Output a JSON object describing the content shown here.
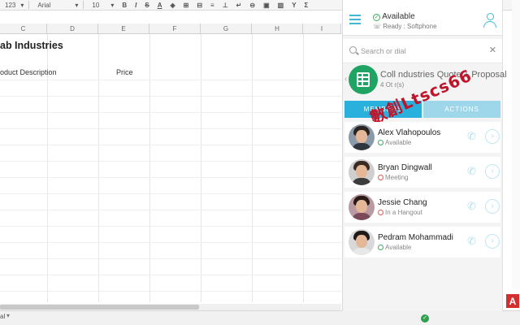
{
  "toolbar": {
    "zoom_text": "123",
    "font_name": "Arial",
    "font_size": "10",
    "bold_label": "B",
    "italic_label": "I",
    "strike_label": "S",
    "color_label": "A"
  },
  "sheet": {
    "columns": [
      "C",
      "D",
      "E",
      "F",
      "G",
      "H",
      "I"
    ],
    "title_cell": "ab Industries",
    "desc_header": "oduct Description",
    "price_header": "Price",
    "tab_label": "al"
  },
  "panel": {
    "status": "Available",
    "device": "Ready : Softphone",
    "search_placeholder": "Search or dial",
    "clear_glyph": "✕",
    "doc_title": "Coll    ndustries Quote + Proposal",
    "doc_subtitle": "4 Ot     r(s)",
    "watermark": "數創Ltscs66",
    "tabs": [
      "MEMBERS",
      "ACTIONS"
    ],
    "contacts": [
      {
        "name": "Alex Vlahopoulos",
        "status": "Available",
        "status_color": "#3bb05a",
        "hair": "#2a2522",
        "shirt": "#2f3640"
      },
      {
        "name": "Bryan Dingwall",
        "status": "Meeting",
        "status_color": "#e05a4f",
        "hair": "#3b2a20",
        "shirt": "#3c3c3c"
      },
      {
        "name": "Jessie Chang",
        "status": "In a Hangout",
        "status_color": "#e05a4f",
        "hair": "#2b1b16",
        "shirt": "#7b4a5a"
      },
      {
        "name": "Pedram Mohammadi",
        "status": "Available",
        "status_color": "#3bb05a",
        "hair": "#1f1a17",
        "shirt": "#e8e8e8"
      }
    ]
  },
  "colors": {
    "accent": "#2ab0dc",
    "available": "#3bb05a",
    "busy": "#e05a4f",
    "sheets_green": "#1fa463"
  },
  "badge_label": "A"
}
